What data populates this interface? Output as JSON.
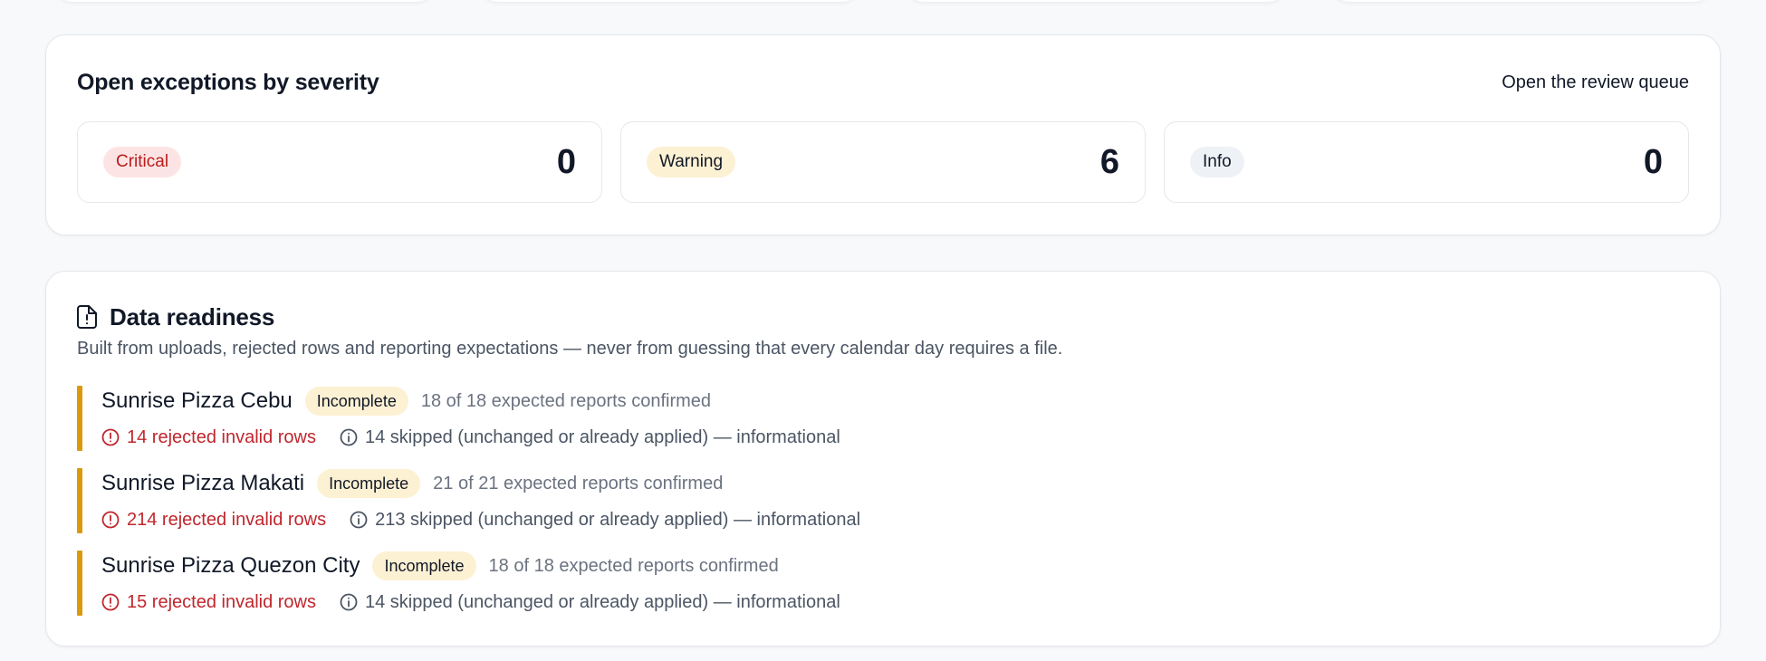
{
  "exceptions": {
    "title": "Open exceptions by severity",
    "review_link": "Open the review queue",
    "severities": [
      {
        "label": "Critical",
        "count": "0"
      },
      {
        "label": "Warning",
        "count": "6"
      },
      {
        "label": "Info",
        "count": "0"
      }
    ]
  },
  "readiness": {
    "title": "Data readiness",
    "subtitle": "Built from uploads, rejected rows and reporting expectations — never from guessing that every calendar day requires a file.",
    "stores": [
      {
        "name": "Sunrise Pizza Cebu",
        "status": "Incomplete",
        "expected": "18 of 18 expected reports confirmed",
        "rejected": "14 rejected invalid rows",
        "skipped": "14 skipped (unchanged or already applied) — informational"
      },
      {
        "name": "Sunrise Pizza Makati",
        "status": "Incomplete",
        "expected": "21 of 21 expected reports confirmed",
        "rejected": "214 rejected invalid rows",
        "skipped": "213 skipped (unchanged or already applied) — informational"
      },
      {
        "name": "Sunrise Pizza Quezon City",
        "status": "Incomplete",
        "expected": "18 of 18 expected reports confirmed",
        "rejected": "15 rejected invalid rows",
        "skipped": "14 skipped (unchanged or already applied) — informational"
      }
    ]
  },
  "colors": {
    "critical": "#b91c1c",
    "warning_bg": "#fdf1d3",
    "accent_bar": "#d99a0c",
    "rejected": "#c0262d"
  },
  "icons": {
    "readiness": "document-alert-icon",
    "rejected": "alert-circle-icon",
    "skipped": "info-circle-icon"
  }
}
